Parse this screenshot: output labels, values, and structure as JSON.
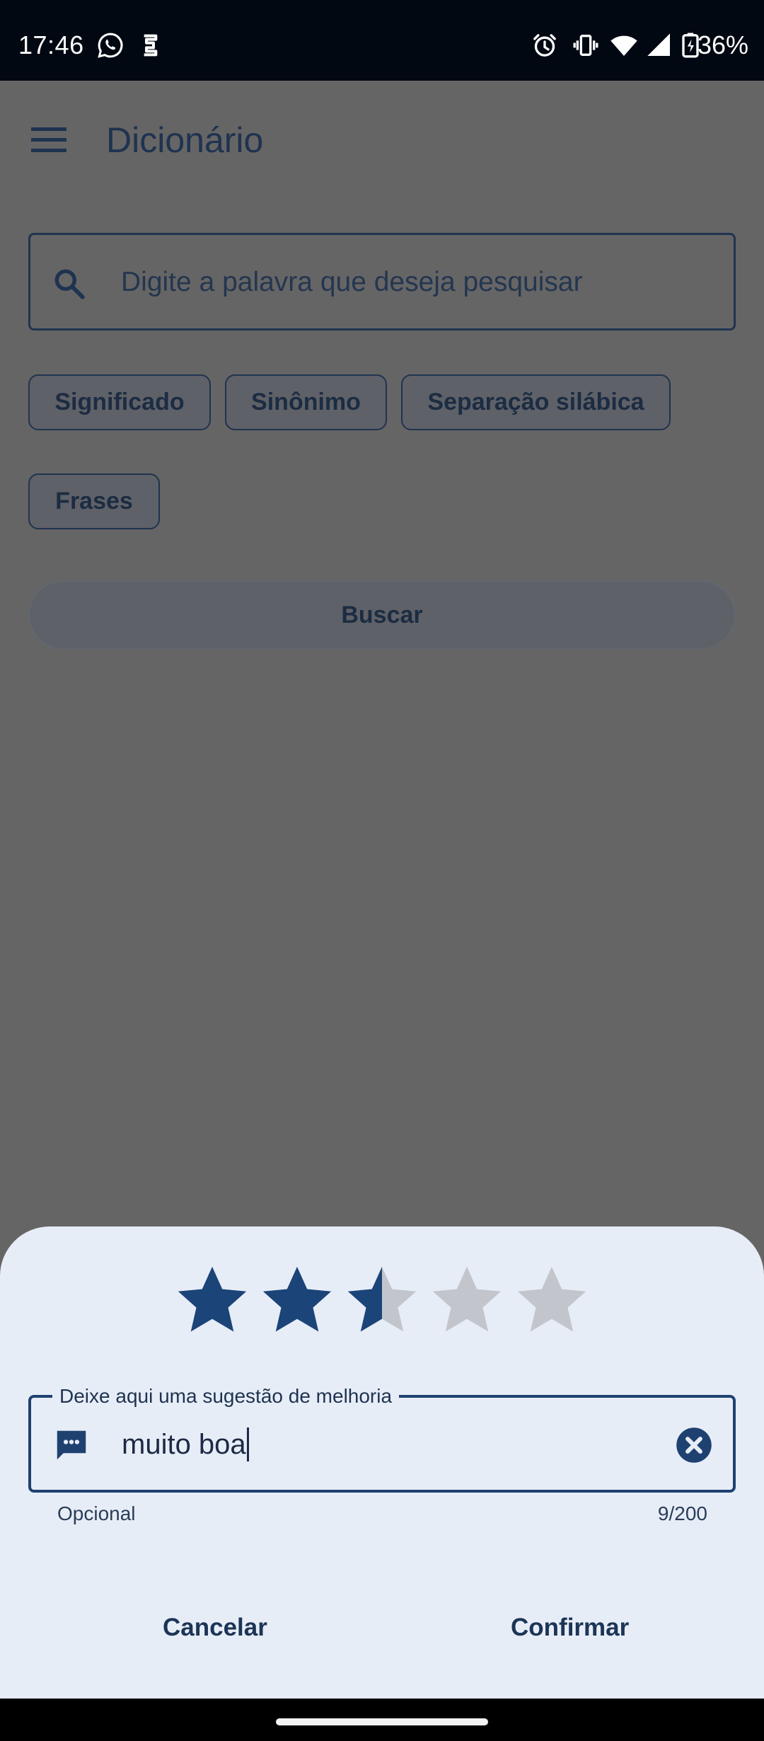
{
  "status_bar": {
    "time": "17:46",
    "battery": "36%",
    "icons": [
      "whatsapp-icon",
      "app-notification-icon",
      "alarm-icon",
      "vibrate-icon",
      "wifi-icon",
      "signal-icon",
      "battery-charging-icon"
    ]
  },
  "app_bar": {
    "title": "Dicionário",
    "menu_icon": "menu-icon"
  },
  "search": {
    "placeholder": "Digite a palavra que deseja pesquisar",
    "icon": "search-icon"
  },
  "chips": [
    "Significado",
    "Sinônimo",
    "Separação silábica",
    "Frases"
  ],
  "search_button": {
    "label": "Buscar"
  },
  "rating_sheet": {
    "rating": 2.5,
    "max_rating": 5,
    "colors": {
      "star_filled": "#1b4478",
      "star_empty": "#c2c6cc",
      "sheet_bg": "#e7edf7",
      "accent": "#1e4170"
    },
    "feedback_field": {
      "label": "Deixe aqui uma sugestão de melhoria",
      "value": "muito boa",
      "helper": "Opcional",
      "counter": "9/200",
      "leading_icon": "message-icon",
      "trailing_icon": "clear-icon"
    },
    "cancel_label": "Cancelar",
    "confirm_label": "Confirmar"
  },
  "scrim_color": "#666565"
}
